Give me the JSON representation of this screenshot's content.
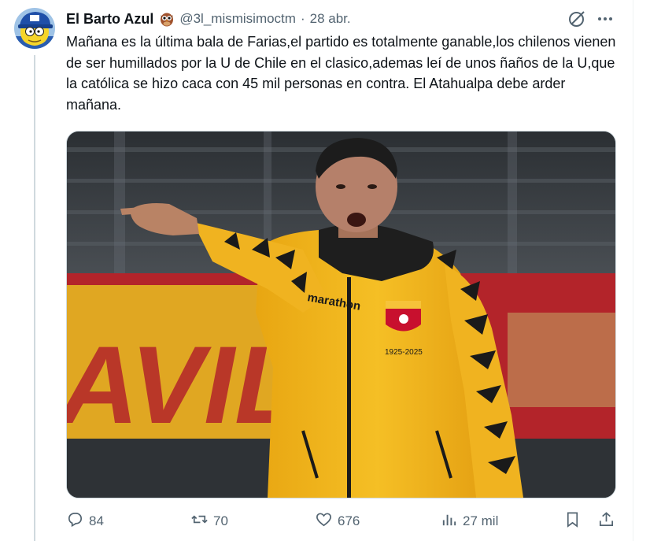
{
  "tweet": {
    "display_name": "El Barto Azul",
    "handle": "@3l_mismisimoctm",
    "separator": "·",
    "date": "28 abr.",
    "text": "Mañana es la última bala de Farias,el partido es totalmente ganable,los chilenos vienen de ser humillados por la U de Chile en el clasico,ademas leí de unos ñaños de la U,que la católica se hizo caca con 45 mil personas en contra. El Atahualpa debe arder mañana.",
    "media": {
      "brand_text": "marathon",
      "crest_text": "1925-2025",
      "banner_text": "AVILA"
    }
  },
  "actions": {
    "replies": "84",
    "reposts": "70",
    "likes": "676",
    "views": "27 mil"
  },
  "icons": [
    "grok-icon",
    "more-icon",
    "reply-icon",
    "repost-icon",
    "like-icon",
    "views-icon",
    "bookmark-icon",
    "share-icon"
  ],
  "colors": {
    "text": "#0f1419",
    "secondary": "#536471",
    "border": "#cfd9de",
    "jersey": "#f2b81c"
  }
}
